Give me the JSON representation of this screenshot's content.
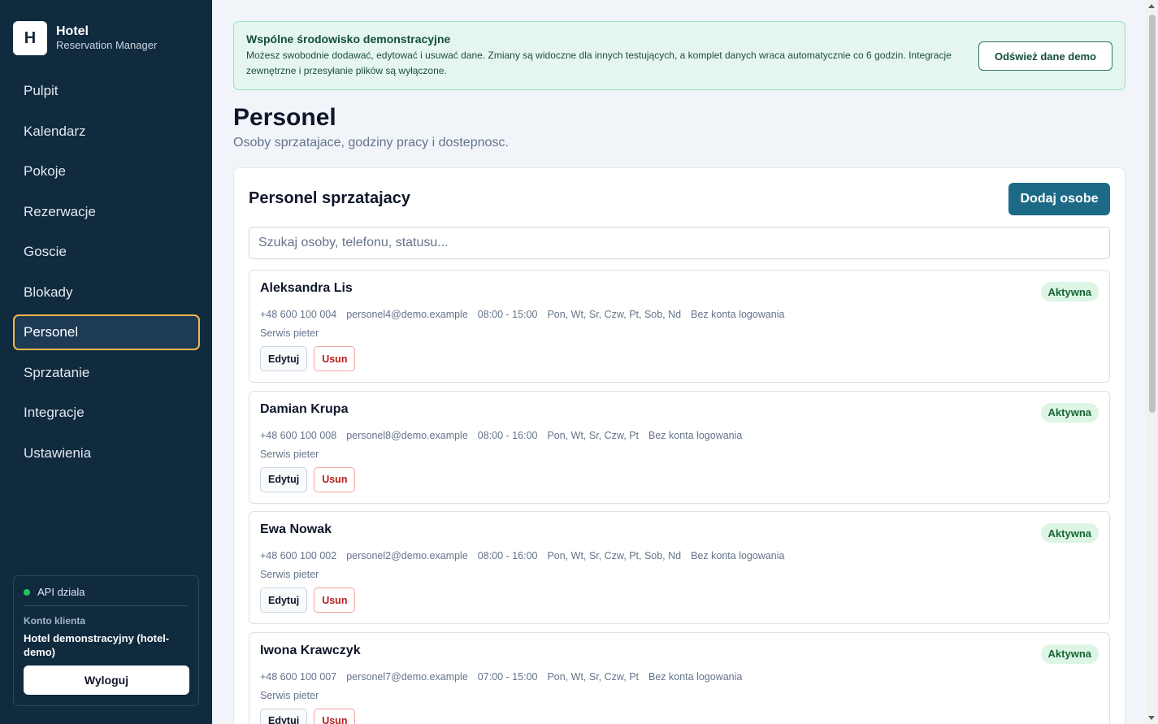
{
  "brand": {
    "logo_letter": "H",
    "title": "Hotel",
    "subtitle": "Reservation Manager"
  },
  "nav": [
    {
      "label": "Pulpit",
      "active": false
    },
    {
      "label": "Kalendarz",
      "active": false
    },
    {
      "label": "Pokoje",
      "active": false
    },
    {
      "label": "Rezerwacje",
      "active": false
    },
    {
      "label": "Goscie",
      "active": false
    },
    {
      "label": "Blokady",
      "active": false
    },
    {
      "label": "Personel",
      "active": true
    },
    {
      "label": "Sprzatanie",
      "active": false
    },
    {
      "label": "Integracje",
      "active": false
    },
    {
      "label": "Ustawienia",
      "active": false
    }
  ],
  "sidebar_card": {
    "api_status": "API dziala",
    "account_label": "Konto klienta",
    "account_name": "Hotel demonstracyjny (hotel-demo)",
    "logout_label": "Wyloguj"
  },
  "banner": {
    "title": "Wspólne środowisko demonstracyjne",
    "text": "Możesz swobodnie dodawać, edytować i usuwać dane. Zmiany są widoczne dla innych testujących, a komplet danych wraca automatycznie co 6 godzin. Integracje zewnętrzne i przesyłanie plików są wyłączone.",
    "button_label": "Odśwież dane demo"
  },
  "page": {
    "title": "Personel",
    "subtitle": "Osoby sprzatajace, godziny pracy i dostepnosc."
  },
  "panel": {
    "title": "Personel sprzatajacy",
    "add_button": "Dodaj osobe",
    "search_placeholder": "Szukaj osoby, telefonu, statusu..."
  },
  "staff": [
    {
      "name": "Aleksandra Lis",
      "status": "Aktywna",
      "phone": "+48 600 100 004",
      "email": "personel4@demo.example",
      "hours": "08:00 - 15:00",
      "days": "Pon, Wt, Sr, Czw, Pt, Sob, Nd",
      "login": "Bez konta logowania",
      "role": "Serwis pieter",
      "edit_label": "Edytuj",
      "delete_label": "Usun"
    },
    {
      "name": "Damian Krupa",
      "status": "Aktywna",
      "phone": "+48 600 100 008",
      "email": "personel8@demo.example",
      "hours": "08:00 - 16:00",
      "days": "Pon, Wt, Sr, Czw, Pt",
      "login": "Bez konta logowania",
      "role": "Serwis pieter",
      "edit_label": "Edytuj",
      "delete_label": "Usun"
    },
    {
      "name": "Ewa Nowak",
      "status": "Aktywna",
      "phone": "+48 600 100 002",
      "email": "personel2@demo.example",
      "hours": "08:00 - 16:00",
      "days": "Pon, Wt, Sr, Czw, Pt, Sob, Nd",
      "login": "Bez konta logowania",
      "role": "Serwis pieter",
      "edit_label": "Edytuj",
      "delete_label": "Usun"
    },
    {
      "name": "Iwona Krawczyk",
      "status": "Aktywna",
      "phone": "+48 600 100 007",
      "email": "personel7@demo.example",
      "hours": "07:00 - 15:00",
      "days": "Pon, Wt, Sr, Czw, Pt",
      "login": "Bez konta logowania",
      "role": "Serwis pieter",
      "edit_label": "Edytuj",
      "delete_label": "Usun"
    }
  ]
}
